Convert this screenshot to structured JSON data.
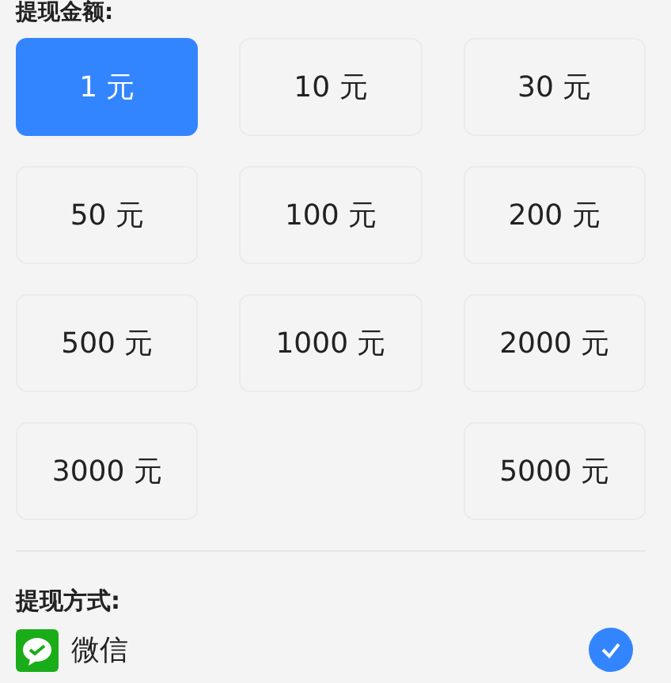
{
  "amount_title": "提现金额:",
  "amounts": [
    {
      "kind": "amount",
      "label": "1 元",
      "selected": true
    },
    {
      "kind": "amount",
      "label": "10 元",
      "selected": false
    },
    {
      "kind": "amount",
      "label": "30 元",
      "selected": false
    },
    {
      "kind": "amount",
      "label": "50 元",
      "selected": false
    },
    {
      "kind": "amount",
      "label": "100 元",
      "selected": false
    },
    {
      "kind": "amount",
      "label": "200 元",
      "selected": false
    },
    {
      "kind": "amount",
      "label": "500 元",
      "selected": false
    },
    {
      "kind": "amount",
      "label": "1000 元",
      "selected": false
    },
    {
      "kind": "amount",
      "label": "2000 元",
      "selected": false
    },
    {
      "kind": "amount",
      "label": "3000 元",
      "selected": false
    },
    {
      "kind": "spacer"
    },
    {
      "kind": "amount",
      "label": "5000 元",
      "selected": false
    }
  ],
  "method_title": "提现方式:",
  "methods": [
    {
      "label": "微信",
      "selected": true
    }
  ]
}
